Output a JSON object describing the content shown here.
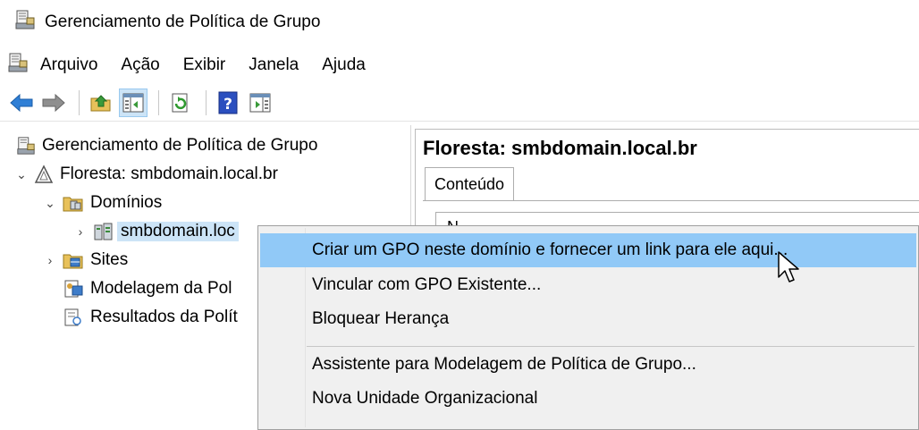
{
  "window": {
    "title": "Gerenciamento de Política de Grupo",
    "icon": "gpmc-icon"
  },
  "menubar": {
    "items": [
      "Arquivo",
      "Ação",
      "Exibir",
      "Janela",
      "Ajuda"
    ]
  },
  "toolbar": {
    "buttons": [
      "back-arrow-icon",
      "forward-arrow-icon",
      "up-folder-icon",
      "show-hide-tree-icon",
      "refresh-icon",
      "help-icon",
      "properties-pane-icon"
    ]
  },
  "tree": {
    "root": "Gerenciamento de Política de Grupo",
    "forest": "Floresta: smbdomain.local.br",
    "domains": "Domínios",
    "domain": "smbdomain.local.br",
    "domain_visible": "smbdomain.loc",
    "sites": "Sites",
    "modeling": "Modelagem da Pol",
    "results": "Resultados da Polít"
  },
  "right_pane": {
    "title": "Floresta: smbdomain.local.br",
    "tab": "Conteúdo",
    "partial_header": "N"
  },
  "context_menu": {
    "items": [
      "Criar um GPO neste domínio e fornecer um link para ele aqui...",
      "Vincular com GPO Existente...",
      "Bloquear Herança",
      "Assistente para Modelagem de Política de Grupo...",
      "Nova Unidade Organizacional"
    ],
    "hovered_index": 0
  },
  "colors": {
    "selection": "#cce4f7",
    "menu_hover": "#91c9f7",
    "menu_bg": "#f0f0f0"
  }
}
